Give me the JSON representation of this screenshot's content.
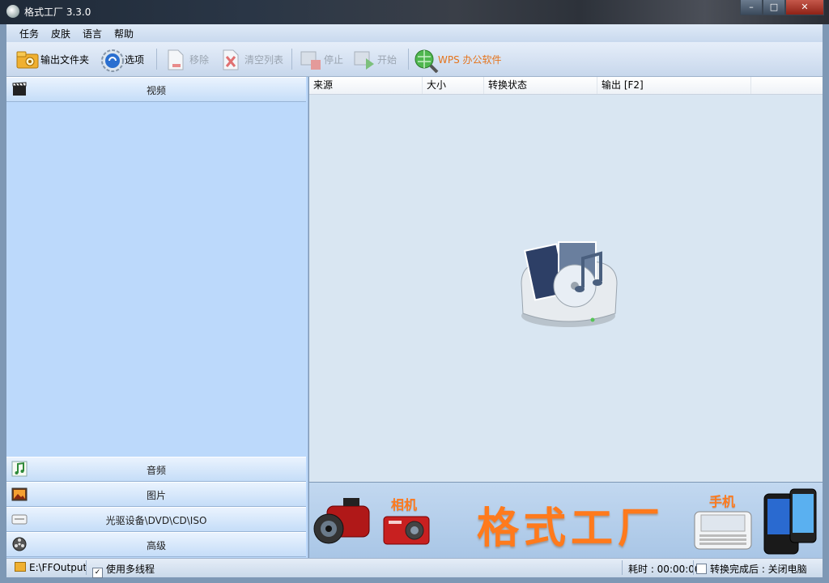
{
  "window": {
    "title": "格式工厂 3.3.0",
    "minimize": "–",
    "maximize": "□",
    "close": "✕"
  },
  "menu": [
    "任务",
    "皮肤",
    "语言",
    "帮助"
  ],
  "toolbar": {
    "output_folder": "输出文件夹",
    "options": "选项",
    "remove": "移除",
    "clear_list": "清空列表",
    "stop": "停止",
    "start": "开始",
    "wps": "WPS 办公软件"
  },
  "categories": {
    "video": "视频",
    "audio": "音频",
    "picture": "图片",
    "rom": "光驱设备\\DVD\\CD\\ISO",
    "advanced": "高级"
  },
  "table": {
    "columns": [
      "来源",
      "大小",
      "转换状态",
      "输出 [F2]"
    ]
  },
  "banner": {
    "title": "格式工厂",
    "camera": "相机",
    "phone": "手机"
  },
  "status": {
    "output_path": "E:\\FFOutput",
    "multithread": "使用多线程",
    "elapsed": "耗时 : 00:00:00",
    "after_done": "转换完成后 : 关闭电脑"
  },
  "colors": {
    "accent_orange": "#ff7a1c",
    "panel_blue": "#bcd9fb",
    "list_bg": "#d9e6f2"
  }
}
